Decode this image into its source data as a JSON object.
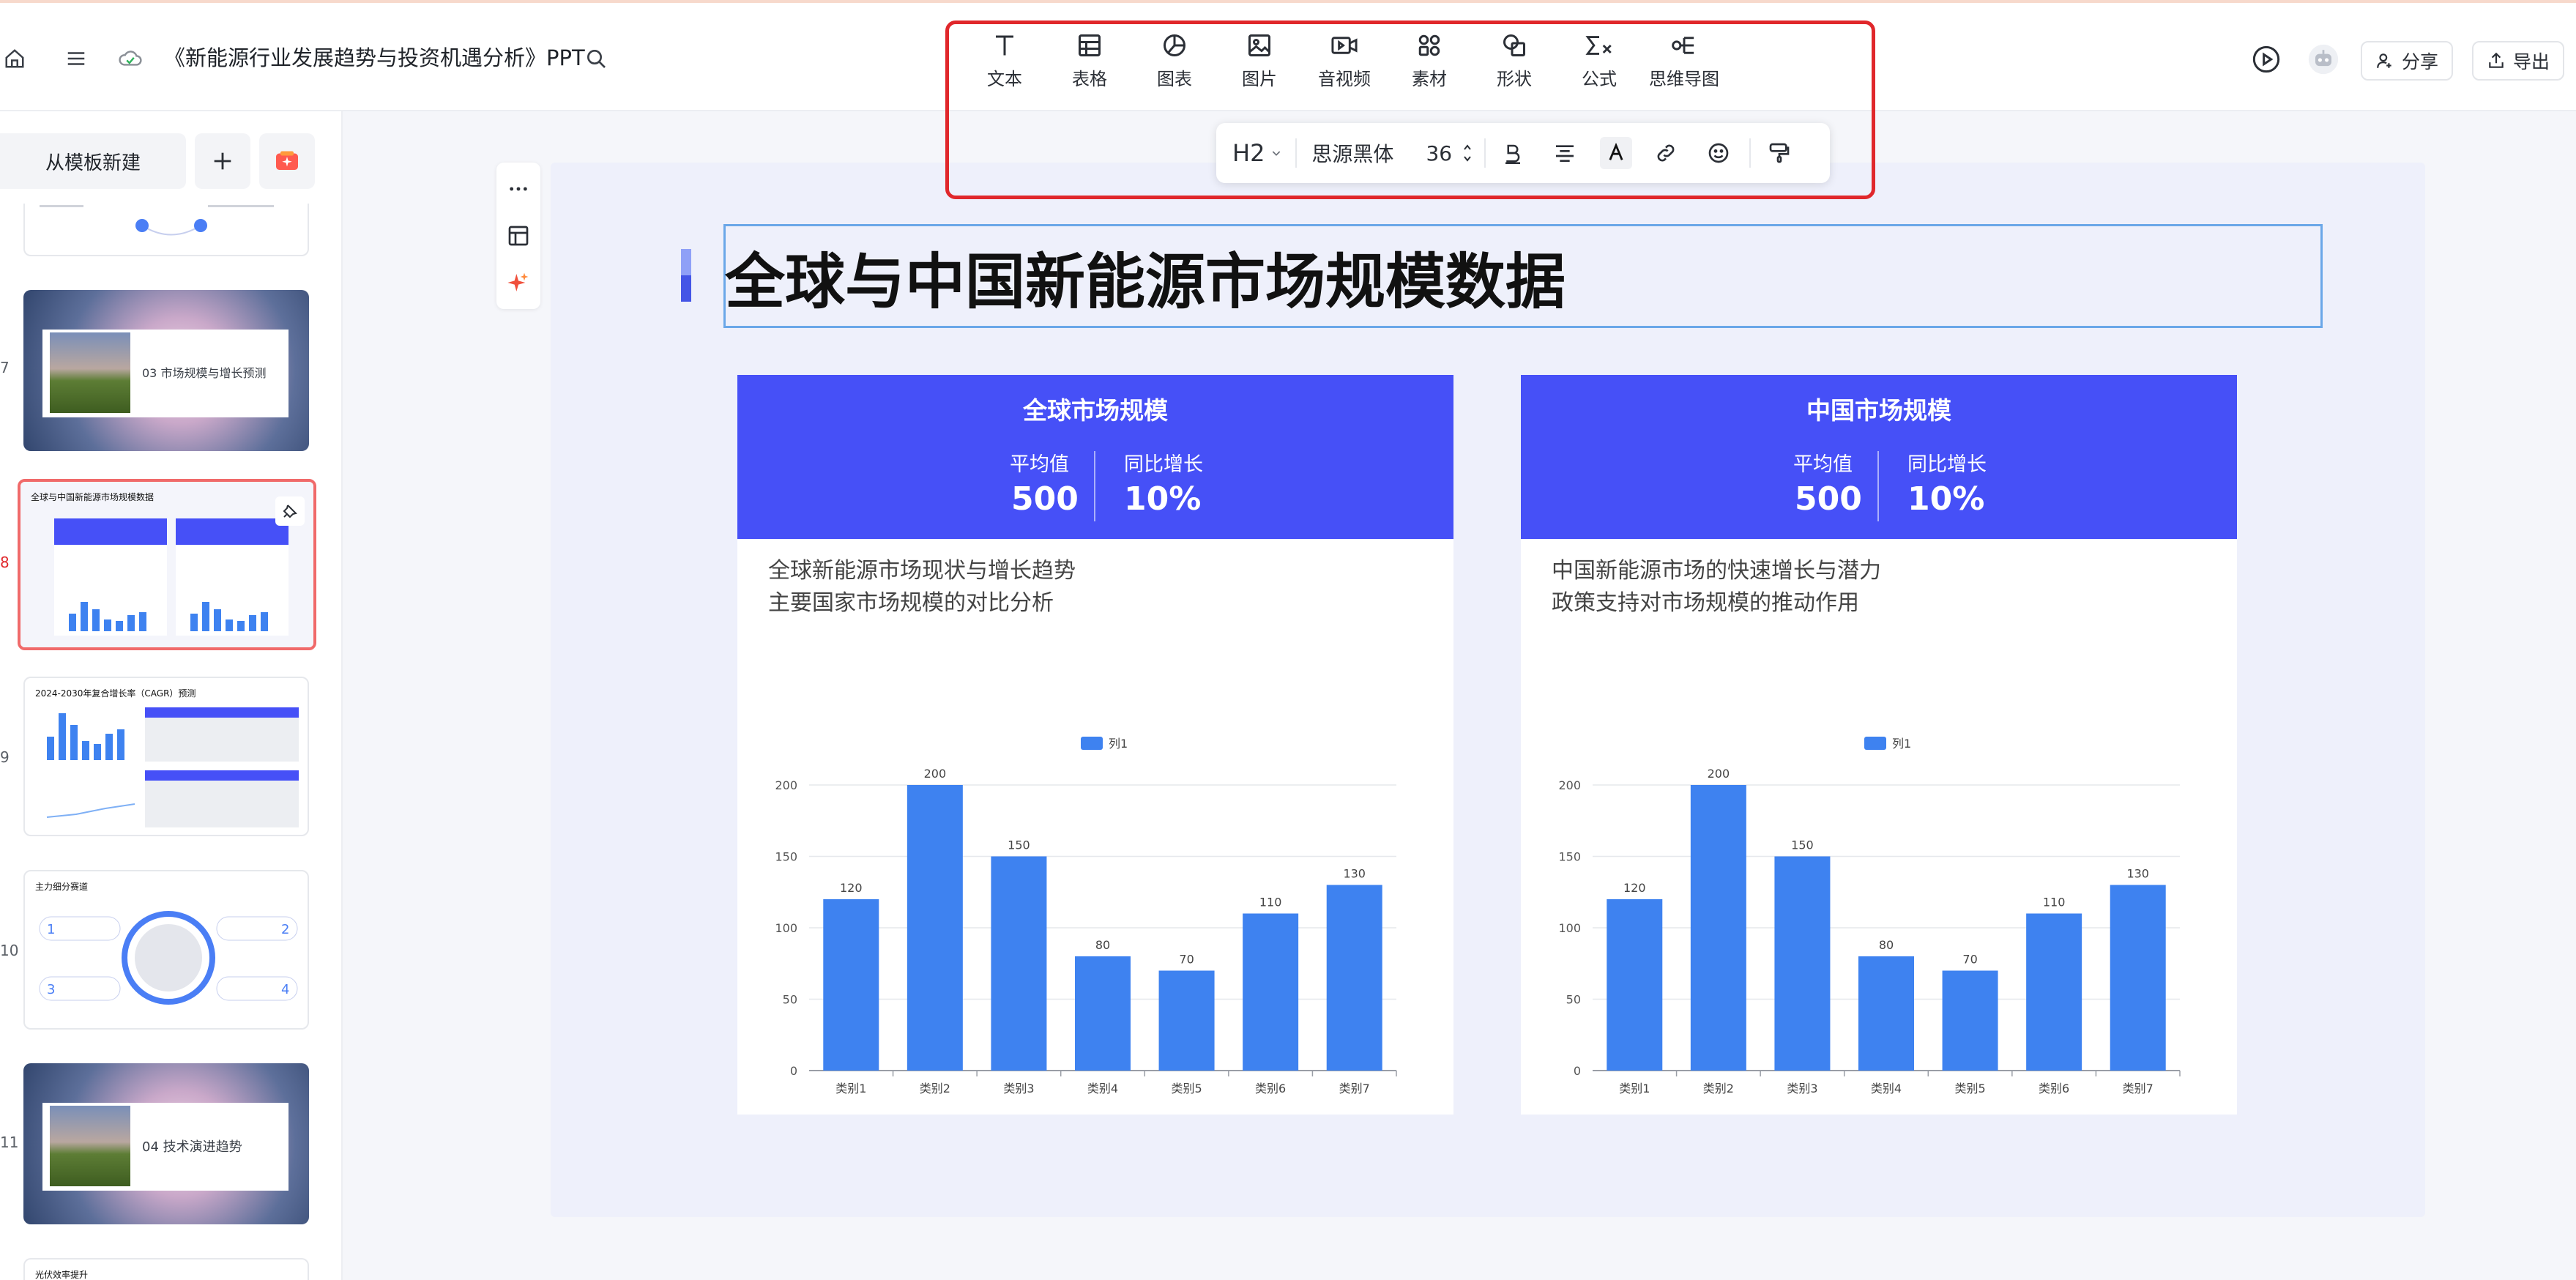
{
  "header": {
    "doc_title": "《新能源行业发展趋势与投资机遇分析》PPT",
    "share_label": "分享",
    "export_label": "导出"
  },
  "insert_toolbar": {
    "items": [
      {
        "label": "文本",
        "icon": "text-icon"
      },
      {
        "label": "表格",
        "icon": "table-icon"
      },
      {
        "label": "图表",
        "icon": "chart-icon"
      },
      {
        "label": "图片",
        "icon": "image-icon"
      },
      {
        "label": "音视频",
        "icon": "video-icon"
      },
      {
        "label": "素材",
        "icon": "assets-icon"
      },
      {
        "label": "形状",
        "icon": "shape-icon"
      },
      {
        "label": "公式",
        "icon": "formula-icon"
      },
      {
        "label": "思维导图",
        "icon": "mindmap-icon"
      }
    ]
  },
  "format_toolbar": {
    "heading": "H2",
    "font_name": "思源黑体",
    "font_size": "36"
  },
  "sidebar": {
    "new_from_template": "从模板新建",
    "slides": [
      {
        "num": "",
        "text": ""
      },
      {
        "num": "7",
        "text": "03  市场规模与增长预测"
      },
      {
        "num": "8",
        "text": "全球与中国新能源市场规模数据"
      },
      {
        "num": "9",
        "text": "2024-2030年复合增长率（CAGR）预测"
      },
      {
        "num": "10",
        "text": "主力细分赛道"
      },
      {
        "num": "11",
        "text": "04  技术演进趋势"
      },
      {
        "num": "",
        "text": "光伏效率提升"
      }
    ]
  },
  "slide": {
    "title": "全球与中国新能源市场规模数据",
    "cards": [
      {
        "title": "全球市场规模",
        "stat1_label": "平均值",
        "stat1_value": "500",
        "stat2_label": "同比增长",
        "stat2_value": "10%",
        "desc1": "全球新能源市场现状与增长趋势",
        "desc2": "主要国家市场规模的对比分析"
      },
      {
        "title": "中国市场规模",
        "stat1_label": "平均值",
        "stat1_value": "500",
        "stat2_label": "同比增长",
        "stat2_value": "10%",
        "desc1": "中国新能源市场的快速增长与潜力",
        "desc2": "政策支持对市场规模的推动作用"
      }
    ]
  },
  "colors": {
    "card_header": "#4650f7",
    "bar": "#3e82f0",
    "highlight_frame": "#e0272b"
  },
  "chart_data": [
    {
      "type": "bar",
      "categories": [
        "类别1",
        "类别2",
        "类别3",
        "类别4",
        "类别5",
        "类别6",
        "类别7"
      ],
      "series": [
        {
          "name": "列1",
          "values": [
            120,
            200,
            150,
            80,
            70,
            110,
            130
          ]
        }
      ],
      "yticks": [
        0,
        50,
        100,
        150,
        200
      ],
      "ylim": [
        0,
        200
      ],
      "legend": "top-center"
    },
    {
      "type": "bar",
      "categories": [
        "类别1",
        "类别2",
        "类别3",
        "类别4",
        "类别5",
        "类别6",
        "类别7"
      ],
      "series": [
        {
          "name": "列1",
          "values": [
            120,
            200,
            150,
            80,
            70,
            110,
            130
          ]
        }
      ],
      "yticks": [
        0,
        50,
        100,
        150,
        200
      ],
      "ylim": [
        0,
        200
      ],
      "legend": "top-center"
    }
  ]
}
